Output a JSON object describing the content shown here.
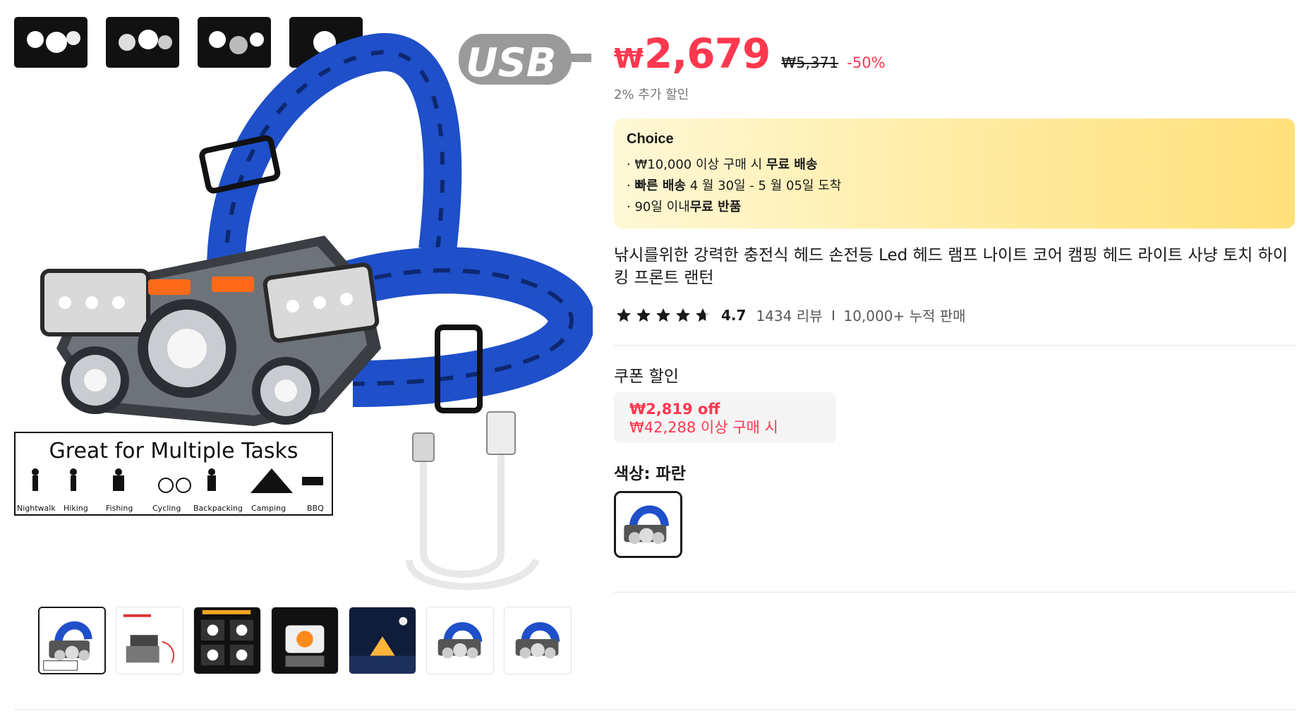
{
  "product": {
    "image_text": {
      "usb_badge": "USB",
      "banner_title": "Great for Multiple Tasks",
      "activities": [
        "Nightwalk",
        "Hiking",
        "Fishing",
        "Cycling",
        "Backpacking",
        "Camping",
        "BBQ"
      ]
    },
    "thumbnails": [
      {
        "name": "thumb-1",
        "active": true
      },
      {
        "name": "thumb-2",
        "active": false
      },
      {
        "name": "thumb-3",
        "active": false
      },
      {
        "name": "thumb-4",
        "active": false
      },
      {
        "name": "thumb-5",
        "active": false
      },
      {
        "name": "thumb-6",
        "active": false
      },
      {
        "name": "thumb-7",
        "active": false
      }
    ],
    "price": {
      "currency_symbol": "₩",
      "current": "2,679",
      "original": "₩5,371",
      "discount": "-50%",
      "extra_discount": "2% 추가 할인"
    },
    "choice": {
      "title": "Choice",
      "line1_prefix": "· ₩10,000 이상 구매 시 ",
      "line1_bold": "무료 배송",
      "line2_bold": "빠른 배송",
      "line2_prefix": "· ",
      "line2_suffix": " 4 월 30일 - 5 월 05일 도착",
      "line3_prefix": "· 90일 이내",
      "line3_bold": "무료 반품"
    },
    "title": "낚시를위한 강력한 충전식 헤드 손전등 Led 헤드 램프 나이트 코어 캠핑 헤드 라이트 사냥 토치 하이킹 프론트 랜턴",
    "rating": {
      "score": "4.7",
      "stars_filled": 4.7,
      "reviews": "1434 리뷰",
      "sold": "10,000+ 누적 판매"
    },
    "coupon": {
      "heading": "쿠폰 할인",
      "amount": "₩2,819 off",
      "condition": "₩42,288 이상 구매 시"
    },
    "color": {
      "label_prefix": "색상: ",
      "selected": "파란"
    }
  },
  "colors": {
    "price_red": "#fd384f",
    "strap_blue": "#1f4fc9",
    "text_dark": "#191919",
    "text_gray": "#757575"
  }
}
